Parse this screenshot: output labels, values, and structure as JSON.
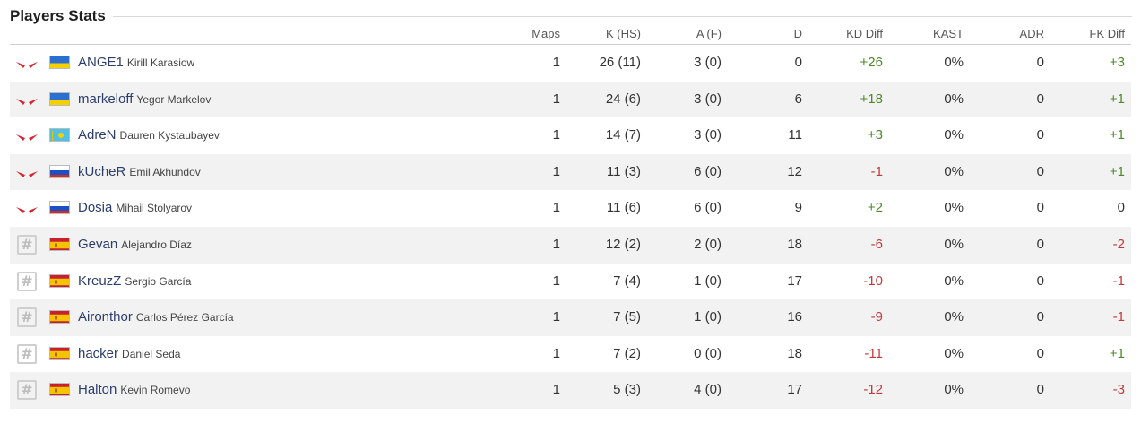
{
  "title": "Players Stats",
  "colors": {
    "positive": "#4d8a2a",
    "negative": "#c0393b",
    "team1_icon": "#d8262f",
    "team2_icon": "#bdbdbd"
  },
  "headers": [
    "Maps",
    "K (HS)",
    "A (F)",
    "D",
    "KD Diff",
    "KAST",
    "ADR",
    "FK Diff"
  ],
  "players": [
    {
      "team_icon": "wings-logo-icon",
      "flag": "ua",
      "nick": "ANGE1",
      "name": "Kirill Karasiow",
      "maps": "1",
      "k": "26 (11)",
      "a": "3 (0)",
      "d": "0",
      "kd": "+26",
      "kast": "0%",
      "adr": "0",
      "fk": "+3"
    },
    {
      "team_icon": "wings-logo-icon",
      "flag": "ua",
      "nick": "markeloff",
      "name": "Yegor Markelov",
      "maps": "1",
      "k": "24 (6)",
      "a": "3 (0)",
      "d": "6",
      "kd": "+18",
      "kast": "0%",
      "adr": "0",
      "fk": "+1"
    },
    {
      "team_icon": "wings-logo-icon",
      "flag": "kz",
      "nick": "AdreN",
      "name": "Dauren Kystaubayev",
      "maps": "1",
      "k": "14 (7)",
      "a": "3 (0)",
      "d": "11",
      "kd": "+3",
      "kast": "0%",
      "adr": "0",
      "fk": "+1"
    },
    {
      "team_icon": "wings-logo-icon",
      "flag": "ru",
      "nick": "kUcheR",
      "name": "Emil Akhundov",
      "maps": "1",
      "k": "11 (3)",
      "a": "6 (0)",
      "d": "12",
      "kd": "-1",
      "kast": "0%",
      "adr": "0",
      "fk": "+1"
    },
    {
      "team_icon": "wings-logo-icon",
      "flag": "ru",
      "nick": "Dosia",
      "name": "Mihail Stolyarov",
      "maps": "1",
      "k": "11 (6)",
      "a": "6 (0)",
      "d": "9",
      "kd": "+2",
      "kast": "0%",
      "adr": "0",
      "fk": "0"
    },
    {
      "team_icon": "hash-icon",
      "flag": "es",
      "nick": "Gevan",
      "name": "Alejandro Díaz",
      "maps": "1",
      "k": "12 (2)",
      "a": "2 (0)",
      "d": "18",
      "kd": "-6",
      "kast": "0%",
      "adr": "0",
      "fk": "-2"
    },
    {
      "team_icon": "hash-icon",
      "flag": "es",
      "nick": "KreuzZ",
      "name": "Sergio García",
      "maps": "1",
      "k": "7 (4)",
      "a": "1 (0)",
      "d": "17",
      "kd": "-10",
      "kast": "0%",
      "adr": "0",
      "fk": "-1"
    },
    {
      "team_icon": "hash-icon",
      "flag": "es",
      "nick": "Aironthor",
      "name": "Carlos Pérez García",
      "maps": "1",
      "k": "7 (5)",
      "a": "1 (0)",
      "d": "16",
      "kd": "-9",
      "kast": "0%",
      "adr": "0",
      "fk": "-1"
    },
    {
      "team_icon": "hash-icon",
      "flag": "es",
      "nick": "hacker",
      "name": "Daniel Seda",
      "maps": "1",
      "k": "7 (2)",
      "a": "0 (0)",
      "d": "18",
      "kd": "-11",
      "kast": "0%",
      "adr": "0",
      "fk": "+1"
    },
    {
      "team_icon": "hash-icon",
      "flag": "es",
      "nick": "Halton",
      "name": "Kevin Romevo",
      "maps": "1",
      "k": "5 (3)",
      "a": "4 (0)",
      "d": "17",
      "kd": "-12",
      "kast": "0%",
      "adr": "0",
      "fk": "-3"
    }
  ]
}
